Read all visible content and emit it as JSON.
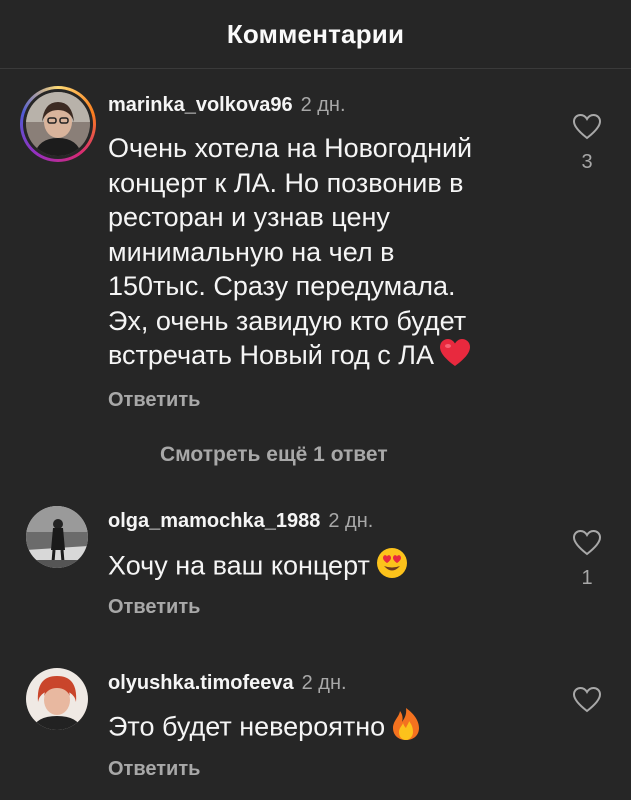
{
  "header": {
    "title": "Комментарии"
  },
  "comments": [
    {
      "username": "marinka_volkova96",
      "time": "2 дн.",
      "text_lines": [
        "Очень хотела на Новогодний",
        "концерт к ЛА. Но позвонив в",
        "ресторан и узнав цену",
        "минимальную на чел в",
        "150тыс. Сразу передумала.",
        "Эх, очень завидую кто будет",
        "встречать Новый год с ЛА"
      ],
      "emoji": "red-heart",
      "reply_label": "Ответить",
      "like_count": "3",
      "view_replies": "Смотреть ещё 1 ответ"
    },
    {
      "username": "olga_mamochka_1988",
      "time": "2 дн.",
      "text": "Хочу на ваш концерт",
      "emoji": "heart-eyes",
      "reply_label": "Ответить",
      "like_count": "1"
    },
    {
      "username": "olyushka.timofeeva",
      "time": "2 дн.",
      "text": "Это будет невероятно",
      "emoji": "fire",
      "reply_label": "Ответить",
      "like_count": ""
    }
  ],
  "colors": {
    "background": "#262626",
    "secondary_text": "#a8a8a8",
    "heart_red": "#e8293e"
  }
}
